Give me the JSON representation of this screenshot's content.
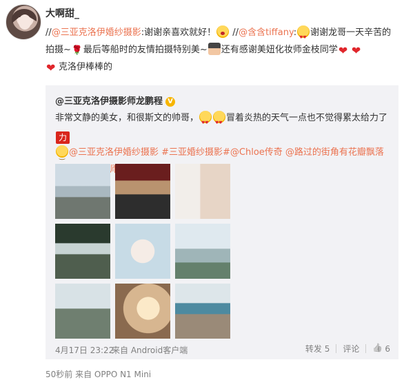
{
  "post": {
    "username": "大啊甜_",
    "text_parts": {
      "p1": "//",
      "m1": "@三亚克洛伊婚纱摄影",
      "p2": ":谢谢亲喜欢就好！",
      "p3": " //",
      "m2": "@含含tiffany",
      "p4": ":",
      "p5": "谢谢龙哥一天辛苦的拍摄~",
      "p6": "最后等船时的友情拍摄特别美~",
      "p7": "还有感谢美妞化妆师金枝同学",
      "p8": "克洛伊棒棒的"
    },
    "footer": "50秒前 来自 OPPO N1 Mini"
  },
  "repost": {
    "author": "@三亚克洛伊摄影师龙鹏程",
    "verified_badge": "V",
    "text_parts": {
      "t1": "非常文静的美女，和很斯文的帅哥，",
      "t2": "冒着炎热的天气一点也不觉得累太给力了",
      "li": "力",
      "tags": "@三亚克洛伊婚纱摄影 #三亚婚纱摄影#@Chloe传奇 @路过的街角有花瓣飘落 @克洛伊化妆师金枝"
    },
    "time": "4月17日 23:22",
    "source": "来自 Android客户端",
    "actions": {
      "repost": "转发 5",
      "comment": "评论",
      "like": "6"
    }
  },
  "icons": {
    "avatar": "user-avatar",
    "verified": "verified-v-icon",
    "like": "thumbs-up-icon"
  },
  "colors": {
    "link": "#eb7350",
    "repost_bg": "#f2f2f5",
    "meta": "#808080"
  }
}
